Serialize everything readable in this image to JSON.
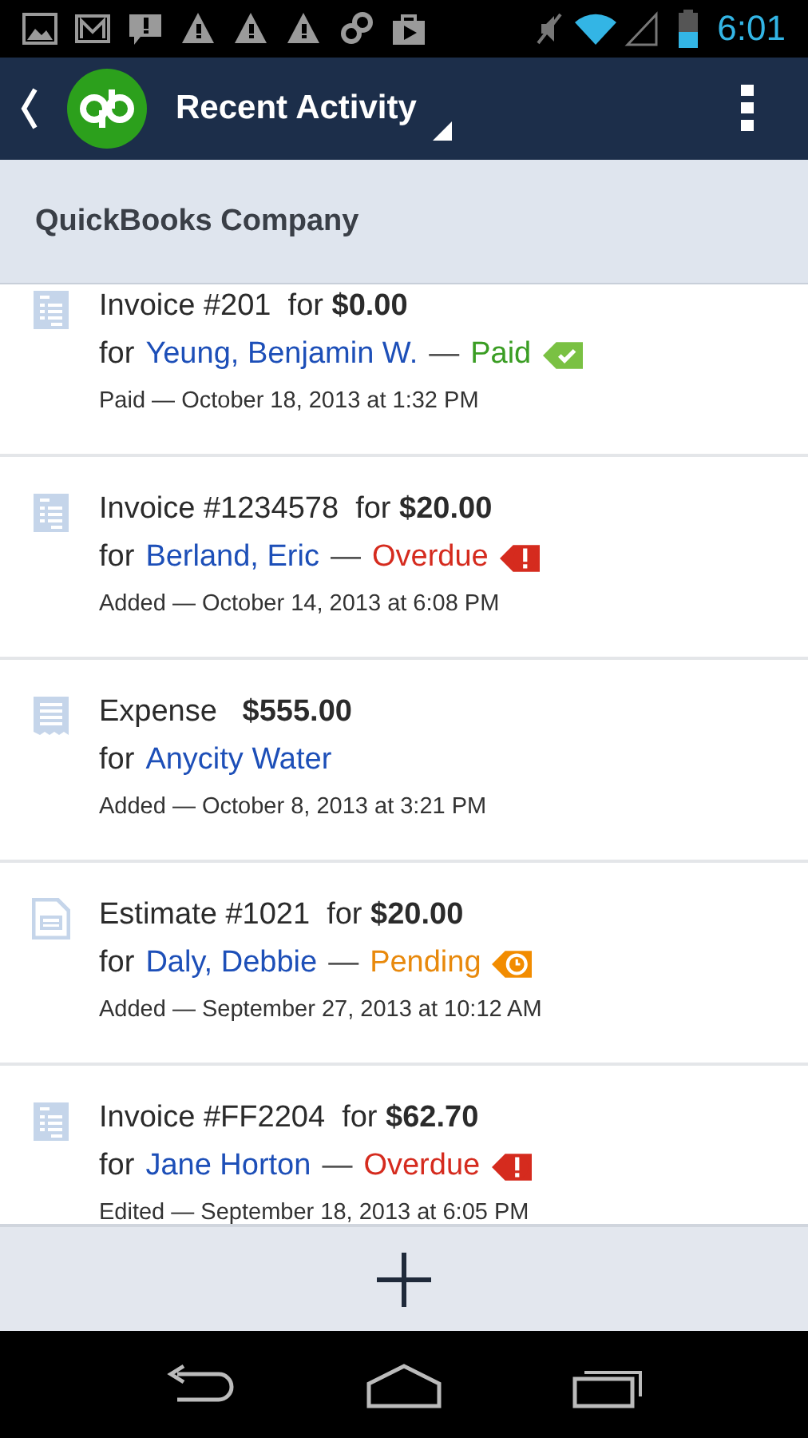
{
  "status_bar": {
    "time": "6:01"
  },
  "app_bar": {
    "title": "Recent Activity"
  },
  "company": {
    "name": "QuickBooks Company"
  },
  "activities": [
    {
      "kind": "invoice",
      "title": "Invoice #201  for **$0.00**",
      "for_label": "for",
      "customer": "Yeung, Benjamin W.",
      "separator": "—",
      "status": {
        "kind": "paid",
        "label": "Paid"
      },
      "meta": "Paid — October 18, 2013 at 1:32 PM"
    },
    {
      "kind": "invoice",
      "title": "Invoice #1234578  for **$20.00**",
      "for_label": "for",
      "customer": "Berland, Eric",
      "separator": "—",
      "status": {
        "kind": "overdue",
        "label": "Overdue"
      },
      "meta": "Added — October 14, 2013 at 6:08 PM"
    },
    {
      "kind": "expense",
      "title": "Expense   **$555.00**",
      "for_label": "for",
      "customer": "Anycity Water",
      "meta": "Added — October 8, 2013 at 3:21 PM"
    },
    {
      "kind": "estimate",
      "title": "Estimate #1021  for **$20.00**",
      "for_label": "for",
      "customer": "Daly, Debbie",
      "separator": "—",
      "status": {
        "kind": "pending",
        "label": "Pending"
      },
      "meta": "Added — September 27, 2013 at 10:12 AM"
    },
    {
      "kind": "invoice",
      "title": "Invoice #FF2204  for **$62.70**",
      "for_label": "for",
      "customer": "Jane Horton",
      "separator": "—",
      "status": {
        "kind": "overdue",
        "label": "Overdue"
      },
      "meta": "Edited — September 18, 2013 at 6:05 PM"
    }
  ]
}
